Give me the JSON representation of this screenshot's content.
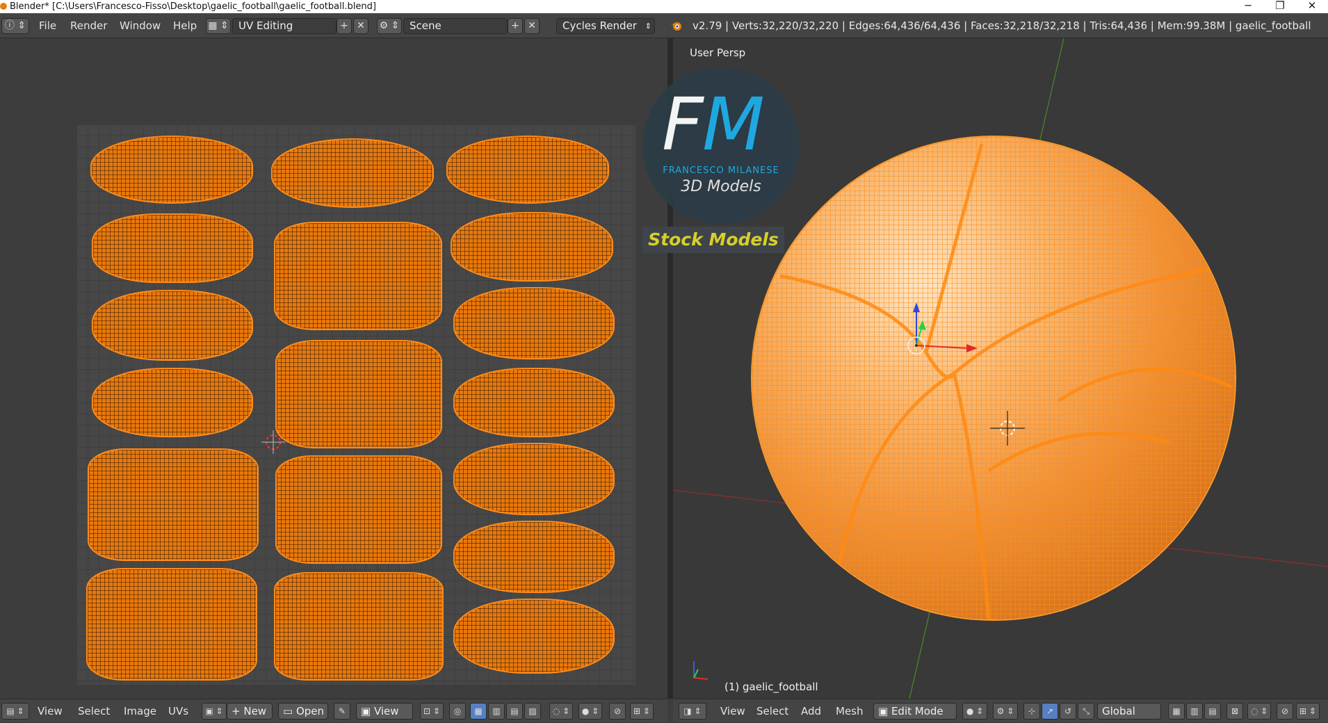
{
  "window": {
    "title": "Blender* [C:\\Users\\Francesco-Fisso\\Desktop\\gaelic_football\\gaelic_football.blend]",
    "minimize": "─",
    "restore": "❐",
    "close": "✕"
  },
  "menu": {
    "file": "File",
    "render": "Render",
    "window": "Window",
    "help": "Help"
  },
  "layout_select": "UV Editing",
  "scene_select": "Scene",
  "engine_select": "Cycles Render",
  "stats": "v2.79 | Verts:32,220/32,220 | Edges:64,436/64,436 | Faces:32,218/32,218 | Tris:64,436 | Mem:99.38M | gaelic_football",
  "viewport": {
    "label": "User Persp",
    "object_label": "(1) gaelic_football"
  },
  "watermark": {
    "letter_f": "F",
    "letter_m": "M",
    "name": "FRANCESCO MILANESE",
    "sub": "3D Models",
    "badge": "Stock Models"
  },
  "uv_header": {
    "view": "View",
    "select": "Select",
    "image": "Image",
    "uvs": "UVs",
    "new": "New",
    "open": "Open",
    "view2": "View"
  },
  "view3d_header": {
    "view": "View",
    "select": "Select",
    "add": "Add",
    "mesh": "Mesh",
    "mode": "Edit Mode",
    "orientation": "Global"
  },
  "colors": {
    "mesh_orange": "#ff8c1a",
    "logo_blue": "#1eaee8",
    "badge_text": "#d6d02a",
    "header_bg": "#444444"
  }
}
